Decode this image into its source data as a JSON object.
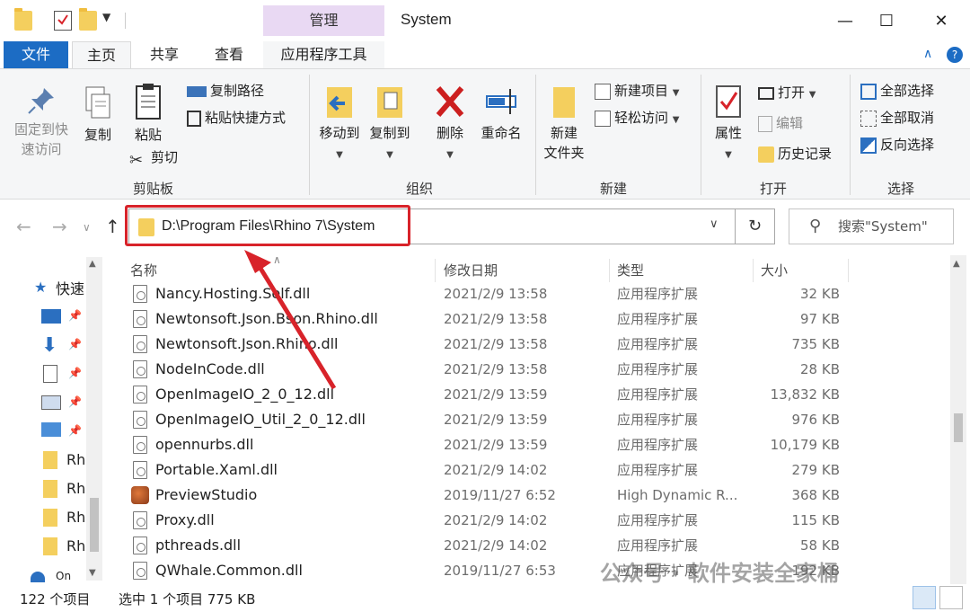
{
  "titlebar": {
    "manage_tab": "管理",
    "window_title": "System",
    "minimize": "—",
    "maximize": "☐",
    "close": "✕"
  },
  "tabs": {
    "file": "文件",
    "home": "主页",
    "share": "共享",
    "view": "查看",
    "app_tools": "应用程序工具",
    "collapse": "∧",
    "help": "?"
  },
  "ribbon": {
    "clipboard": {
      "label": "剪贴板",
      "pin": "固定到快\n速访问",
      "pin_l1": "固定到快",
      "pin_l2": "速访问",
      "copy": "复制",
      "paste": "粘贴",
      "copy_path": "复制路径",
      "paste_shortcut": "粘贴快捷方式",
      "cut": "剪切"
    },
    "organize": {
      "label": "组织",
      "move_to": "移动到",
      "copy_to": "复制到",
      "delete": "删除",
      "rename": "重命名"
    },
    "new": {
      "label": "新建",
      "new_folder_l1": "新建",
      "new_folder_l2": "文件夹",
      "new_item": "新建项目",
      "easy_access": "轻松访问"
    },
    "open": {
      "label": "打开",
      "properties": "属性",
      "open": "打开",
      "edit": "编辑",
      "history": "历史记录"
    },
    "select": {
      "label": "选择",
      "select_all": "全部选择",
      "select_none": "全部取消",
      "invert": "反向选择"
    }
  },
  "address": {
    "path": "D:\\Program Files\\Rhino 7\\System",
    "search_placeholder": "搜索\"System\""
  },
  "navpane": {
    "quick_access": "快速",
    "items": [
      "Rh",
      "Rh",
      "Rh",
      "Rh"
    ],
    "bottom": "On"
  },
  "columns": {
    "name": "名称",
    "date": "修改日期",
    "type": "类型",
    "size": "大小"
  },
  "files": [
    {
      "name": "Nancy.Hosting.Self.dll",
      "date": "2021/2/9 13:58",
      "type": "应用程序扩展",
      "size": "32 KB"
    },
    {
      "name": "Newtonsoft.Json.Bson.Rhino.dll",
      "date": "2021/2/9 13:58",
      "type": "应用程序扩展",
      "size": "97 KB"
    },
    {
      "name": "Newtonsoft.Json.Rhino.dll",
      "date": "2021/2/9 13:58",
      "type": "应用程序扩展",
      "size": "735 KB"
    },
    {
      "name": "NodeInCode.dll",
      "date": "2021/2/9 13:58",
      "type": "应用程序扩展",
      "size": "28 KB"
    },
    {
      "name": "OpenImageIO_2_0_12.dll",
      "date": "2021/2/9 13:59",
      "type": "应用程序扩展",
      "size": "13,832 KB"
    },
    {
      "name": "OpenImageIO_Util_2_0_12.dll",
      "date": "2021/2/9 13:59",
      "type": "应用程序扩展",
      "size": "976 KB"
    },
    {
      "name": "opennurbs.dll",
      "date": "2021/2/9 13:59",
      "type": "应用程序扩展",
      "size": "10,179 KB"
    },
    {
      "name": "Portable.Xaml.dll",
      "date": "2021/2/9 14:02",
      "type": "应用程序扩展",
      "size": "279 KB"
    },
    {
      "name": "PreviewStudio",
      "date": "2019/11/27 6:52",
      "type": "High Dynamic R...",
      "size": "368 KB"
    },
    {
      "name": "Proxy.dll",
      "date": "2021/2/9 14:02",
      "type": "应用程序扩展",
      "size": "115 KB"
    },
    {
      "name": "pthreads.dll",
      "date": "2021/2/9 14:02",
      "type": "应用程序扩展",
      "size": "58 KB"
    },
    {
      "name": "QWhale.Common.dll",
      "date": "2019/11/27 6:53",
      "type": "应用程序扩展",
      "size": "192 KB"
    }
  ],
  "status": {
    "count": "122 个项目",
    "selected": "选中 1 个项目  775 KB"
  },
  "watermark": "公众号 · 软件安装全家桶",
  "colors": {
    "file_tab": "#1c6cc4",
    "manage_tab": "#e9d9f3",
    "highlight": "#d8232a"
  }
}
